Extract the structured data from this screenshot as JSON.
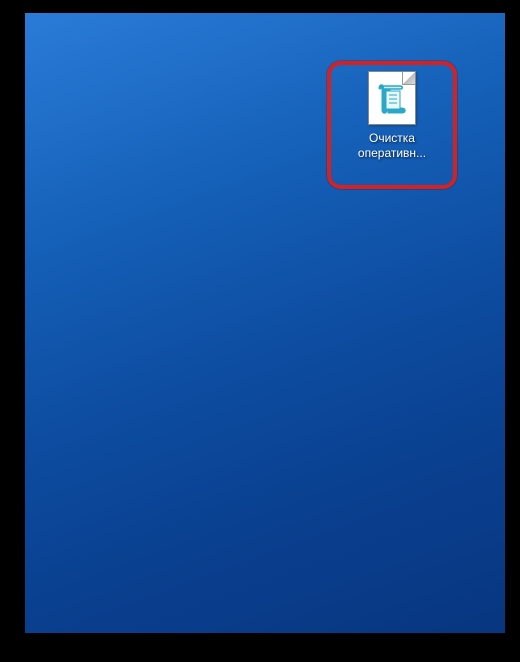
{
  "desktop": {
    "icons": [
      {
        "name": "script-file-icon",
        "label_line1": "Очистка",
        "label_line2": "оперативн..."
      }
    ]
  },
  "annotation": {
    "highlight_color": "#d82020"
  }
}
